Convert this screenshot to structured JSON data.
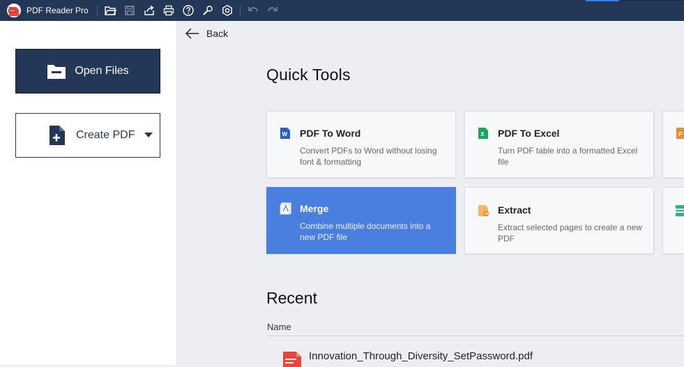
{
  "app": {
    "title": "PDF Reader Pro"
  },
  "toolbar": {
    "buttons": [
      {
        "name": "open-folder-icon",
        "disabled": false
      },
      {
        "name": "save-icon",
        "disabled": true
      },
      {
        "name": "share-icon",
        "disabled": false
      },
      {
        "name": "print-icon",
        "disabled": false
      },
      {
        "name": "help-icon",
        "disabled": false
      },
      {
        "name": "tools-icon",
        "disabled": false
      },
      {
        "name": "settings-icon",
        "disabled": false
      },
      {
        "name": "undo-icon",
        "disabled": true
      },
      {
        "name": "redo-icon",
        "disabled": true
      }
    ]
  },
  "sidebar": {
    "open_files_label": "Open Files",
    "create_pdf_label": "Create PDF"
  },
  "nav": {
    "back_label": "Back"
  },
  "quick_tools": {
    "heading": "Quick Tools",
    "cards": [
      {
        "title": "PDF To Word",
        "desc": "Convert PDFs to Word without losing font & formatting",
        "icon": "word-icon",
        "color": "#2b5fb3"
      },
      {
        "title": "PDF To Excel",
        "desc": "Turn PDF table into a formatted Excel file",
        "icon": "excel-icon",
        "color": "#1aa463"
      },
      {
        "title": "Merge",
        "desc": "Combine multiple documents into a new PDF file",
        "icon": "merge-icon",
        "selected": true
      },
      {
        "title": "Extract",
        "desc": "Extract selected pages to create a new PDF",
        "icon": "extract-icon",
        "color": "#f0a040"
      }
    ]
  },
  "recent": {
    "heading": "Recent",
    "column_name": "Name",
    "files": [
      {
        "name": "Innovation_Through_Diversity_SetPassword.pdf"
      }
    ]
  },
  "colors": {
    "titlebar": "#243757",
    "accent": "#4a7fe0",
    "pdf_red": "#e8453c"
  }
}
